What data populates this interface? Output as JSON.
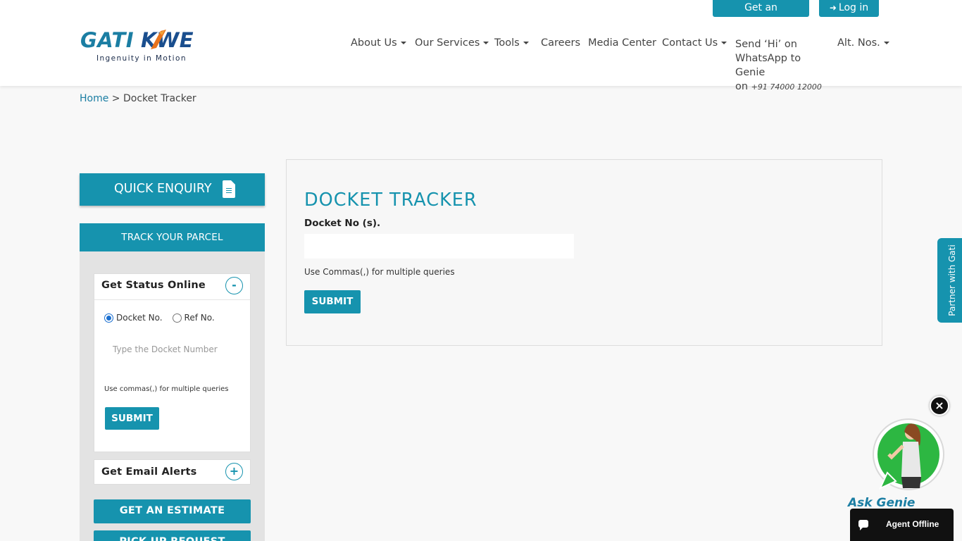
{
  "header": {
    "estimate_button": "Get an Estimate",
    "login_button": "Log in",
    "logo": {
      "gati": "GATI",
      "kwe": "KWE",
      "tagline": "Ingenuity in Motion"
    },
    "nav": {
      "about": "About Us",
      "services": "Our Services",
      "tools": "Tools",
      "careers": "Careers",
      "media": "Media Center",
      "contact": "Contact Us",
      "whatsapp_line1": "Send ‘Hi’ on",
      "whatsapp_line2": "WhatsApp to Genie",
      "whatsapp_on": "on",
      "whatsapp_number": "+91 74000 12000",
      "alt_nos": "Alt. Nos."
    }
  },
  "breadcrumb": {
    "home": "Home",
    "separator": ">",
    "current": "Docket Tracker"
  },
  "sidebar": {
    "quick_enquiry": "QUICK ENQUIRY",
    "track_title": "TRACK YOUR PARCEL",
    "status": {
      "title": "Get Status Online",
      "toggle": "-",
      "radio_docket": "Docket No.",
      "radio_ref": "Ref No.",
      "input_placeholder": "Type the Docket Number",
      "hint": "Use commas(,) for multiple queries",
      "submit": "SUBMIT"
    },
    "alerts": {
      "title": "Get Email Alerts",
      "toggle": "+"
    },
    "estimate_button": "GET AN ESTIMATE",
    "pickup_button": "PICK UP REQUEST"
  },
  "main": {
    "title": "DOCKET TRACKER",
    "label": "Docket No (s).",
    "input_value": "",
    "hint": "Use Commas(,) for multiple queries",
    "submit": "SUBMIT"
  },
  "partner_tab": "Partner with Gati",
  "genie": {
    "close": "×",
    "label": "Ask Genie",
    "agent_status": "Agent Offline"
  },
  "colors": {
    "primary": "#1693ae",
    "logo_blue": "#1a4e8e",
    "whatsapp_green": "#2db742",
    "page_bg": "#f8f8f8"
  }
}
